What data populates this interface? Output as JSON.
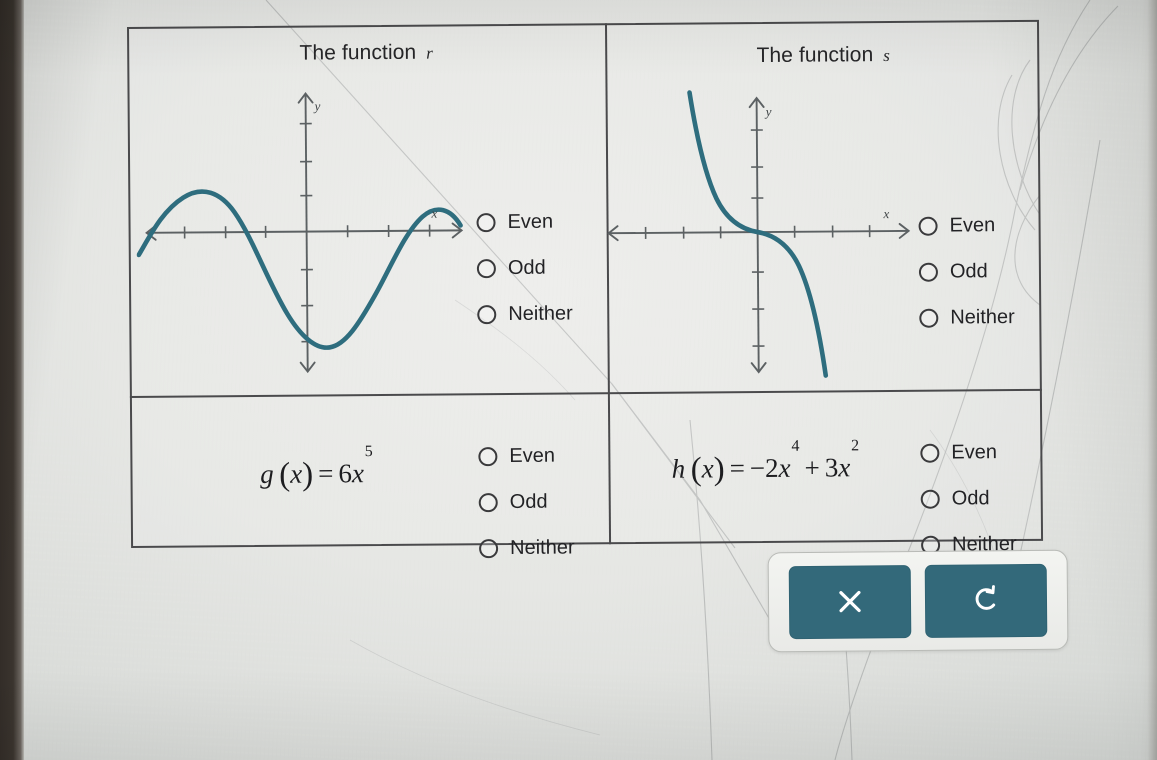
{
  "worksheet": {
    "cells": [
      {
        "id": "r",
        "type": "graph",
        "title_prefix": "The function",
        "title_fn": "r",
        "axis_x_label": "x",
        "axis_y_label": "y",
        "options": [
          "Even",
          "Odd",
          "Neither"
        ],
        "selected": null
      },
      {
        "id": "s",
        "type": "graph",
        "title_prefix": "The function",
        "title_fn": "s",
        "axis_x_label": "x",
        "axis_y_label": "y",
        "options": [
          "Even",
          "Odd",
          "Neither"
        ],
        "selected": null
      },
      {
        "id": "g",
        "type": "formula",
        "formula": {
          "name": "g",
          "arg": "x",
          "eq": "=",
          "terms": [
            {
              "coef": "6",
              "var": "x",
              "exp": "5"
            }
          ],
          "plain": "g (x) = 6x^5"
        },
        "options": [
          "Even",
          "Odd",
          "Neither"
        ],
        "selected": null
      },
      {
        "id": "h",
        "type": "formula",
        "formula": {
          "name": "h",
          "arg": "x",
          "eq": "=",
          "terms": [
            {
              "coef": "−2",
              "var": "x",
              "exp": "4"
            },
            {
              "op": "+",
              "coef": "3",
              "var": "x",
              "exp": "2"
            }
          ],
          "plain": "h (x) = −2x^4 + 3x^2"
        },
        "options": [
          "Even",
          "Odd",
          "Neither"
        ],
        "selected": null
      }
    ]
  },
  "actionbar": {
    "buttons": [
      {
        "name": "clear-button",
        "icon": "close-x-icon",
        "label": "×"
      },
      {
        "name": "undo-button",
        "icon": "undo-arrow-icon",
        "label": "↺"
      }
    ]
  },
  "colors": {
    "curve": "#2e6d7e",
    "axis": "#5c6163",
    "button_fill": "#33697a",
    "button_icon": "#ffffff",
    "table_border": "#4a4a4c",
    "text": "#222225",
    "paper": "#e6e7e4"
  },
  "chart_data": [
    {
      "type": "line",
      "id": "r",
      "title": "The function r",
      "xlabel": "x",
      "ylabel": "y",
      "grid": false,
      "legend": "none",
      "xlim": [
        -6,
        6
      ],
      "ylim": [
        -4,
        3
      ],
      "description": "Sinusoid-like wave: rises to a local maximum near y=1 on the left, falls to a deep minimum near y=-3 just right of the origin, then rises again to a local maximum near y=1 on the right. Not symmetric about the y-axis nor about the origin.",
      "points": [
        [
          -6.0,
          0.45
        ],
        [
          -5.5,
          0.9
        ],
        [
          -5.0,
          1.05
        ],
        [
          -4.5,
          0.95
        ],
        [
          -4.0,
          0.55
        ],
        [
          -3.5,
          -0.1
        ],
        [
          -3.0,
          -0.85
        ],
        [
          -2.5,
          -1.65
        ],
        [
          -2.0,
          -2.35
        ],
        [
          -1.5,
          -2.85
        ],
        [
          -1.0,
          -3.05
        ],
        [
          -0.6,
          -3.0
        ],
        [
          -0.2,
          -2.75
        ],
        [
          0.3,
          -2.2
        ],
        [
          0.8,
          -1.5
        ],
        [
          1.3,
          -0.75
        ],
        [
          1.8,
          -0.05
        ],
        [
          2.3,
          0.55
        ],
        [
          2.8,
          0.95
        ],
        [
          3.3,
          1.05
        ],
        [
          3.8,
          0.85
        ],
        [
          4.2,
          0.5
        ]
      ]
    },
    {
      "type": "line",
      "id": "s",
      "title": "The function s",
      "xlabel": "x",
      "ylabel": "y",
      "grid": false,
      "legend": "none",
      "xlim": [
        -6,
        6
      ],
      "ylim": [
        -5,
        3
      ],
      "description": "Decreasing cubic-like curve, y = -x^3 shape: steeply positive on the left, flattens through the origin with an inflection point at (0,0), then falls steeply to the lower right. Symmetric about the origin.",
      "points": [
        [
          -2.3,
          3.0
        ],
        [
          -2.0,
          2.2
        ],
        [
          -1.7,
          1.45
        ],
        [
          -1.4,
          0.9
        ],
        [
          -1.1,
          0.5
        ],
        [
          -0.8,
          0.22
        ],
        [
          -0.5,
          0.07
        ],
        [
          -0.2,
          0.01
        ],
        [
          0.0,
          0.0
        ],
        [
          0.2,
          -0.01
        ],
        [
          0.5,
          -0.07
        ],
        [
          0.8,
          -0.22
        ],
        [
          1.1,
          -0.5
        ],
        [
          1.4,
          -0.9
        ],
        [
          1.7,
          -1.45
        ],
        [
          2.0,
          -2.2
        ],
        [
          2.3,
          -3.0
        ],
        [
          2.6,
          -4.0
        ],
        [
          2.85,
          -4.9
        ]
      ]
    }
  ]
}
